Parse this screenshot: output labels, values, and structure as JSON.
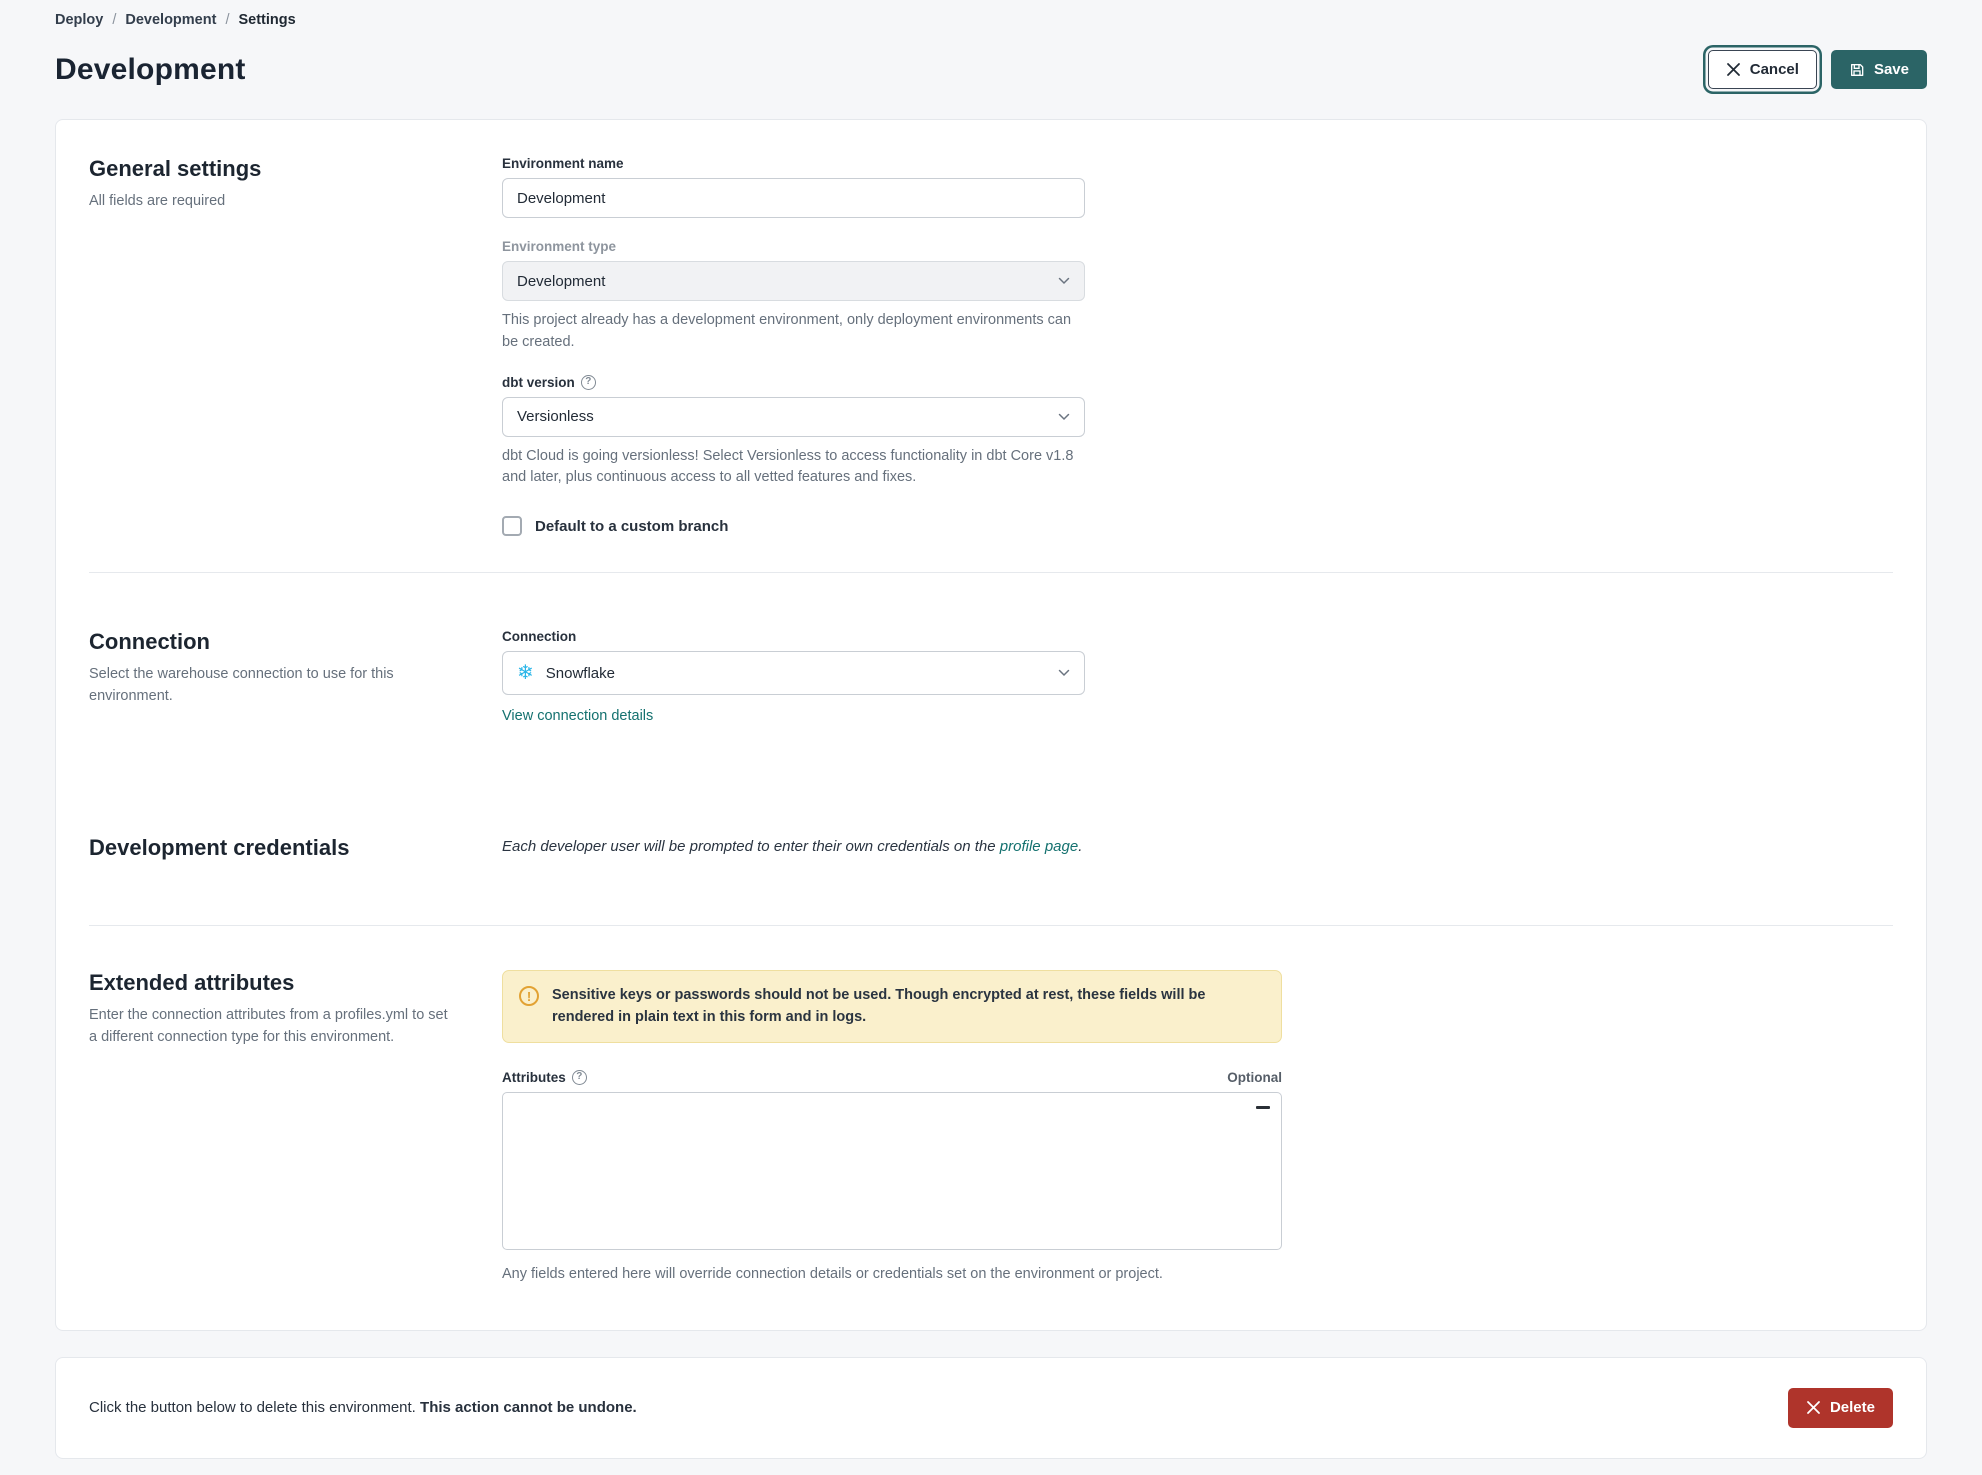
{
  "breadcrumb": {
    "items": [
      "Deploy",
      "Development",
      "Settings"
    ],
    "separator": "/"
  },
  "page": {
    "title": "Development"
  },
  "actions": {
    "cancel": "Cancel",
    "save": "Save"
  },
  "icons": {
    "snowflake": "❄"
  },
  "colors": {
    "accent_teal": "#2B6466",
    "link_teal": "#14716F",
    "danger_red": "#AF342B",
    "warning_bg": "#FAF0CC",
    "warning_icon": "#E2A233",
    "snowflake_blue": "#29B5E8",
    "page_bg": "#F6F7F9"
  },
  "general": {
    "heading": "General settings",
    "subheading": "All fields are required",
    "env_name": {
      "label": "Environment name",
      "value": "Development"
    },
    "env_type": {
      "label": "Environment type",
      "value": "Development",
      "help": "This project already has a development environment, only deployment environments can be created."
    },
    "dbt_version": {
      "label": "dbt version",
      "value": "Versionless",
      "help": "dbt Cloud is going versionless! Select Versionless to access functionality in dbt Core v1.8 and later, plus continuous access to all vetted features and fixes."
    },
    "custom_branch": {
      "label": "Default to a custom branch",
      "checked": false
    }
  },
  "connection": {
    "heading": "Connection",
    "subheading": "Select the warehouse connection to use for this environment.",
    "field_label": "Connection",
    "value": "Snowflake",
    "link": "View connection details"
  },
  "credentials": {
    "heading": "Development credentials",
    "note_prefix": "Each developer user will be prompted to enter their own credentials on the ",
    "note_link": "profile page",
    "note_suffix": "."
  },
  "extended": {
    "heading": "Extended attributes",
    "subheading": "Enter the connection attributes from a profiles.yml to set a different connection type for this environment.",
    "warning": "Sensitive keys or passwords should not be used. Though encrypted at rest, these fields will be rendered in plain text in this form and in logs.",
    "attributes_label": "Attributes",
    "optional_label": "Optional",
    "attributes_value": "",
    "helper": "Any fields entered here will override connection details or credentials set on the environment or project."
  },
  "danger": {
    "text": "Click the button below to delete this environment. ",
    "text_bold": "This action cannot be undone.",
    "delete_label": "Delete"
  }
}
